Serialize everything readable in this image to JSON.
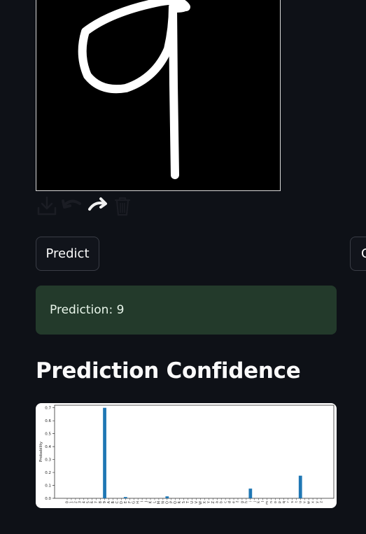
{
  "canvas": {
    "drawn_digit": "9",
    "toolbar": {
      "download_icon": "download-icon",
      "undo_icon": "undo-icon",
      "redo_icon": "redo-icon",
      "delete_icon": "trash-icon"
    }
  },
  "buttons": {
    "predict_label": "Predict",
    "clear_label": "C"
  },
  "result": {
    "prediction_text": "Prediction: 9"
  },
  "section": {
    "confidence_heading": "Prediction Confidence"
  },
  "colors": {
    "background": "#0e1117",
    "bar": "#1f77b4",
    "success_bg": "#233a2b"
  },
  "chart_data": {
    "type": "bar",
    "categories": [
      "0",
      "1",
      "2",
      "3",
      "4",
      "5",
      "6",
      "7",
      "8",
      "9",
      "A",
      "B",
      "C",
      "D",
      "E",
      "F",
      "G",
      "H",
      "I",
      "J",
      "K",
      "L",
      "M",
      "N",
      "O",
      "P",
      "Q",
      "R",
      "S",
      "T",
      "U",
      "V",
      "W",
      "X",
      "Y",
      "Z",
      "a",
      "b",
      "c",
      "d",
      "e",
      "f",
      "g",
      "h",
      "i",
      "j",
      "k",
      "l",
      "m",
      "n",
      "o",
      "p",
      "q",
      "r",
      "s",
      "t",
      "u",
      "v",
      "w",
      "x",
      "y",
      "z"
    ],
    "values": [
      0,
      0,
      0,
      0,
      0,
      0,
      0,
      0,
      0,
      0.7,
      0,
      0,
      0,
      0,
      0.01,
      0,
      0,
      0,
      0,
      0,
      0,
      0,
      0,
      0,
      0.015,
      0,
      0,
      0,
      0,
      0,
      0,
      0,
      0,
      0,
      0,
      0,
      0,
      0,
      0,
      0,
      0,
      0,
      0,
      0,
      0.075,
      0,
      0,
      0,
      0,
      0,
      0,
      0,
      0,
      0,
      0,
      0,
      0.175,
      0,
      0,
      0,
      0,
      0
    ],
    "ylabel": "Probability",
    "xlabel": "",
    "title": "",
    "ylim": [
      0,
      0.72
    ],
    "yticks": [
      "0.0",
      "0.1",
      "0.2",
      "0.3",
      "0.4",
      "0.5",
      "0.6",
      "0.7"
    ],
    "grid": false
  }
}
